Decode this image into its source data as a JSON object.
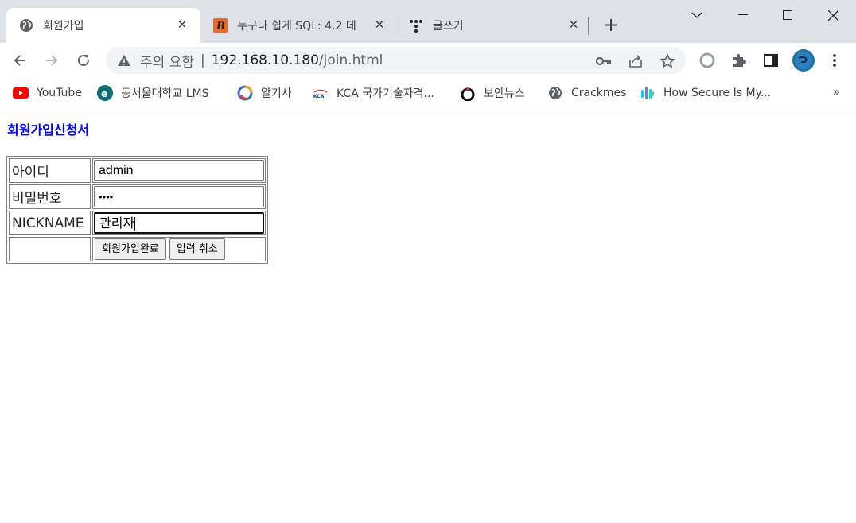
{
  "browser": {
    "tabs": [
      {
        "title": "회원가입",
        "active": true
      },
      {
        "title": "누구나 쉽게 SQL: 4.2 데",
        "active": false
      },
      {
        "title": "글쓰기",
        "active": false
      }
    ],
    "new_tab": "+",
    "address": {
      "security_label": "주의 요함",
      "separator": "|",
      "host": "192.168.10.180",
      "path": "/join.html"
    },
    "bookmarks": [
      {
        "label": "YouTube",
        "icon": "youtube-icon"
      },
      {
        "label": "동서울대학교 LMS",
        "icon": "university-icon"
      },
      {
        "label": "알기사",
        "icon": "algisa-icon"
      },
      {
        "label": "KCA 국가기술자격...",
        "icon": "kca-icon"
      },
      {
        "label": "보안뉴스",
        "icon": "boannews-icon"
      },
      {
        "label": "Crackmes",
        "icon": "globe-icon"
      },
      {
        "label": "How Secure Is My...",
        "icon": "hsimp-icon"
      }
    ],
    "bookmarks_more": "»",
    "colors": {
      "tabstrip": "#dee1e6",
      "omnibox": "#f1f3f4",
      "title_blue": "#0000ff"
    }
  },
  "page": {
    "title": "회원가입신청서",
    "form": {
      "id_label": "아이디",
      "id_value": "admin",
      "password_label": "비밀번호",
      "password_value": "••••",
      "nickname_label": "NICKNAME",
      "nickname_value": "관리자",
      "submit_label": "회원가입완료",
      "reset_label": "입력 취소"
    }
  }
}
